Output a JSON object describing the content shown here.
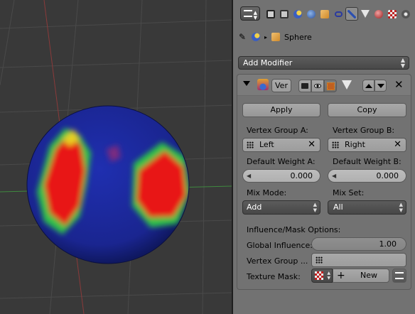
{
  "viewport": {
    "sphere_colors": {
      "base": "#1a2a9c",
      "hot": "#e81818",
      "mid": "#2ec24a"
    }
  },
  "header": {
    "tabs": [
      "render-icon",
      "render-layers-icon",
      "scene-icon",
      "world-icon",
      "object-icon",
      "constraints-icon",
      "modifiers-icon",
      "object-data-icon",
      "material-icon",
      "texture-icon",
      "particles-icon"
    ]
  },
  "breadcrumb": {
    "object_name": "Sphere"
  },
  "add_modifier": {
    "label": "Add Modifier"
  },
  "modifier": {
    "name": "Ver",
    "apply_label": "Apply",
    "copy_label": "Copy",
    "vertex_group_a_label": "Vertex Group A:",
    "vertex_group_a": "Left",
    "vertex_group_b_label": "Vertex Group B:",
    "vertex_group_b": "Right",
    "default_weight_a_label": "Default Weight A:",
    "default_weight_a": "0.000",
    "default_weight_b_label": "Default Weight B:",
    "default_weight_b": "0.000",
    "mix_mode_label": "Mix Mode:",
    "mix_mode": "Add",
    "mix_set_label": "Mix Set:",
    "mix_set": "All",
    "influence_section": "Influence/Mask Options:",
    "global_influence_label": "Global Influence:",
    "global_influence": "1.00",
    "vertex_group_mask_label": "Vertex Group ...",
    "texture_mask_label": "Texture Mask:",
    "new_label": "New"
  }
}
